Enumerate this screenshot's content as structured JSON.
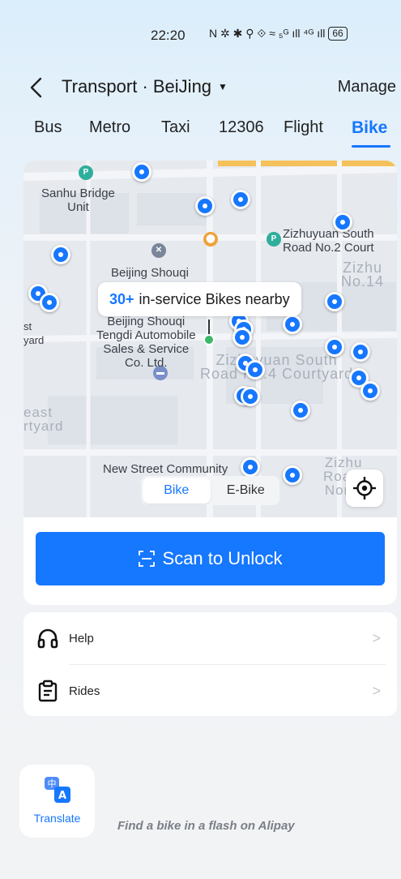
{
  "status_bar": {
    "time": "22:20",
    "icons": "N ✲ ✱ ⚲ ⟐ ≈ ₅ᴳ ıll ⁴ᴳ ıll",
    "battery": "66"
  },
  "header": {
    "title": "Transport · BeiJing",
    "manage_label": "Manage"
  },
  "tabs": [
    {
      "label": "Bus"
    },
    {
      "label": "Metro"
    },
    {
      "label": "Taxi"
    },
    {
      "label": "12306"
    },
    {
      "label": "Flight"
    },
    {
      "label": "Bike",
      "active": true
    }
  ],
  "map": {
    "labels": {
      "sanhu": "Sanhu Bridge\nUnit",
      "zizhuyuan_south": "Zizhuyuan South\nRoad No.2 Court",
      "beijing_shouqi": "Beijing Shouqi",
      "shouqi_tengdi": "Beijing Shouqi\nTengdi Automobile\nSales & Service\nCo. Ltd.",
      "zizhuyuan_court": "Zizhuyuan South\nRoad No.4 Courtyard",
      "new_street": "New Street Community",
      "zizhu_right": "Zizhu\nNo.14",
      "zizhu_small": "Zizhu\nNo.14",
      "east_yard": "east\nrtyard",
      "st_yard": "st\nyard",
      "zizhu_bottom": "Zizhu\nRoa o\nNorth"
    },
    "callout_count": "30+",
    "callout_text": "in-service Bikes nearby",
    "toggle": [
      {
        "label": "Bike",
        "active": true
      },
      {
        "label": "E-Bike",
        "active": false
      }
    ],
    "accent_color": "#1677ff"
  },
  "scan_button": {
    "label": "Scan to Unlock"
  },
  "menu": [
    {
      "label": "Help",
      "icon": "headphones-icon"
    },
    {
      "label": "Rides",
      "icon": "clipboard-icon"
    }
  ],
  "translate": {
    "label": "Translate"
  },
  "slogan": "Find a bike in a flash on Alipay"
}
